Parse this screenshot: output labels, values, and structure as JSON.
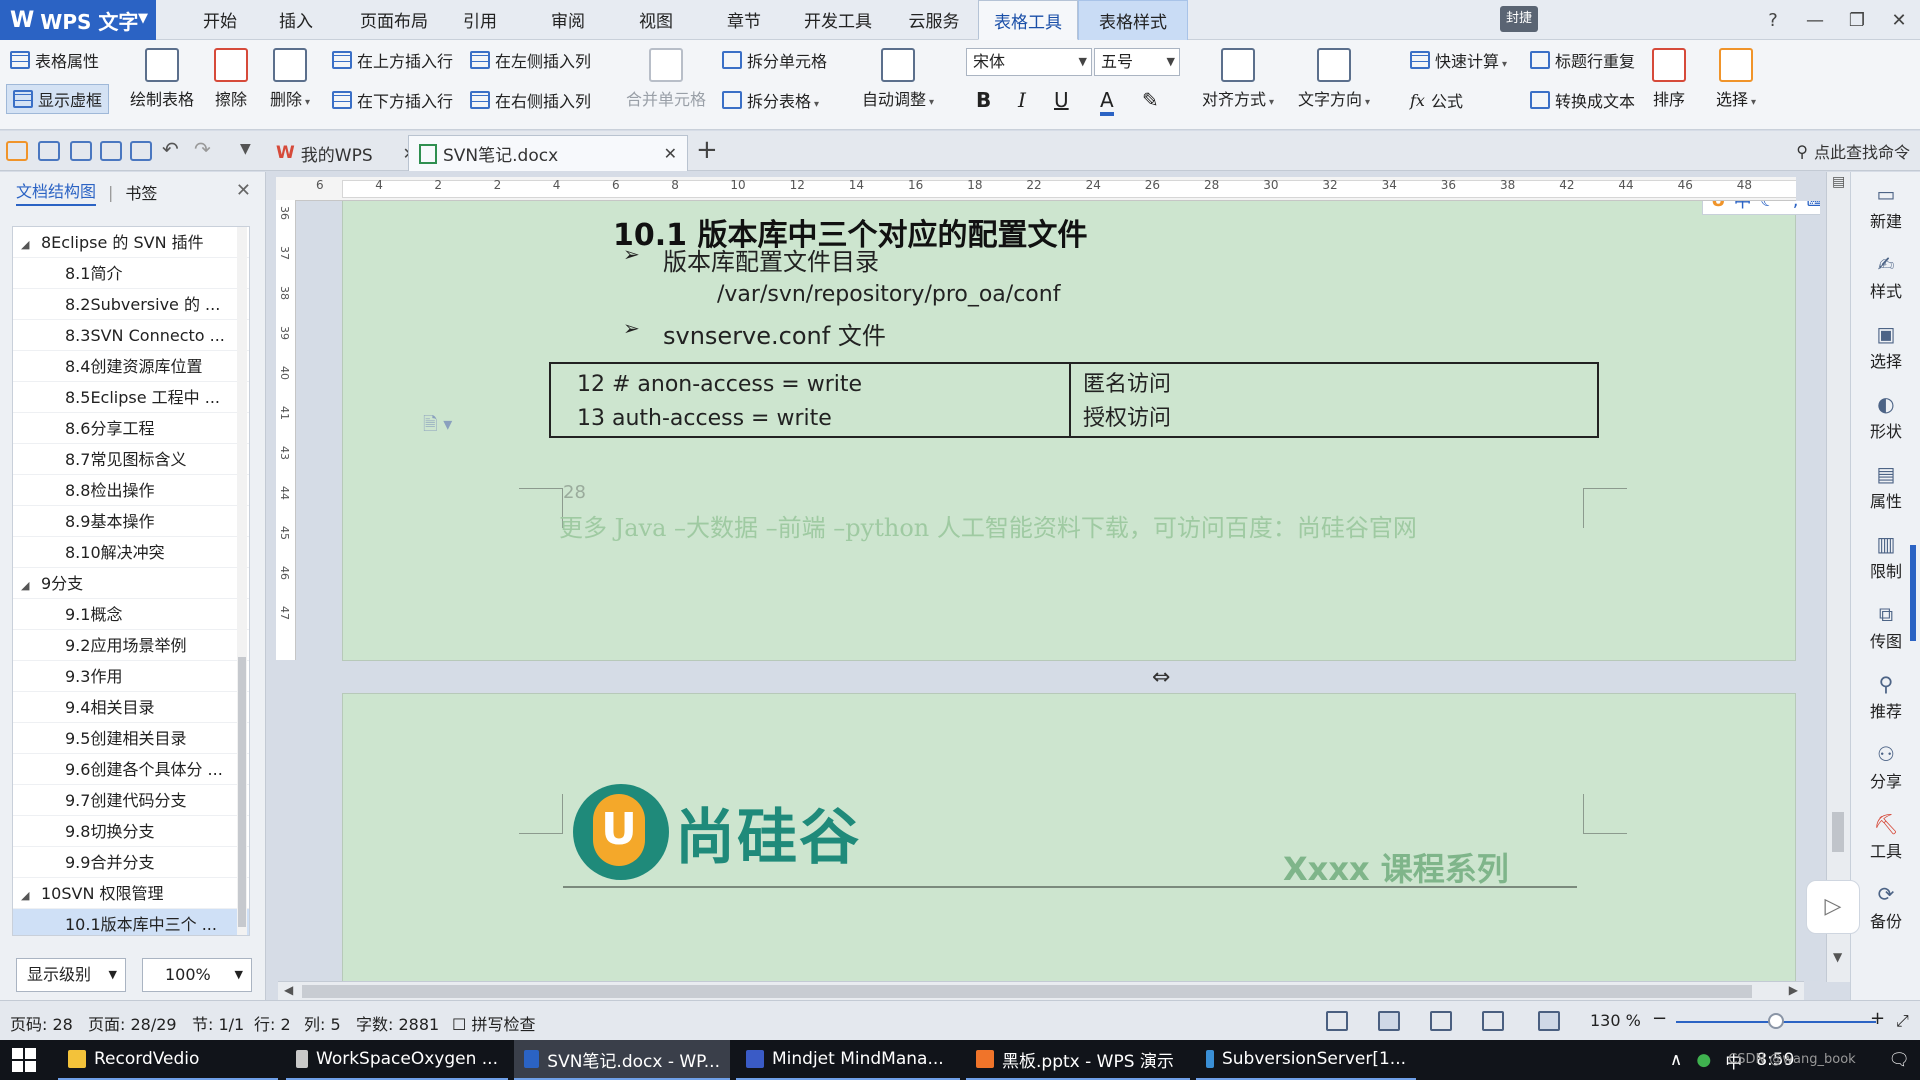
{
  "menubar": {
    "app_label": "WPS 文字",
    "tabs": [
      "开始",
      "插入",
      "页面布局",
      "引用",
      "审阅",
      "视图",
      "章节",
      "开发工具",
      "云服务",
      "表格工具",
      "表格样式"
    ],
    "user_label": "封捷",
    "window_controls": [
      "?",
      "—",
      "❐",
      "✕"
    ]
  },
  "ribbon": {
    "table_props": "表格属性",
    "show_gridlines": "显示虚框",
    "draw_table": "绘制表格",
    "eraser": "擦除",
    "delete": "删除",
    "insert_above": "在上方插入行",
    "insert_below": "在下方插入行",
    "insert_left": "在左侧插入列",
    "insert_right": "在右侧插入列",
    "merge_cells": "合并单元格",
    "split_cells": "拆分单元格",
    "split_table": "拆分表格",
    "auto_fit": "自动调整",
    "font_name": "宋体",
    "font_size": "五号",
    "bold": "B",
    "italic": "I",
    "underline": "U",
    "font_color": "A",
    "align": "对齐方式",
    "text_direction": "文字方向",
    "quick_calc": "快速计算",
    "formula": "公式",
    "repeat_header": "标题行重复",
    "to_text": "转换成文本",
    "sort": "排序",
    "select": "选择"
  },
  "tabbar": {
    "home_tab": "我的WPS",
    "doc_tab": "SVN笔记.docx",
    "search_cmd": "点此查找命令"
  },
  "nav": {
    "tab_outline": "文档结构图",
    "tab_bookmark": "书签",
    "items": [
      {
        "label": "8Eclipse 的 SVN 插件",
        "level": 1
      },
      {
        "label": "8.1简介",
        "level": 2
      },
      {
        "label": "8.2Subversive 的 ...",
        "level": 2
      },
      {
        "label": "8.3SVN Connecto ...",
        "level": 2
      },
      {
        "label": "8.4创建资源库位置",
        "level": 2
      },
      {
        "label": "8.5Eclipse 工程中 ...",
        "level": 2
      },
      {
        "label": "8.6分享工程",
        "level": 2
      },
      {
        "label": "8.7常见图标含义",
        "level": 2
      },
      {
        "label": "8.8检出操作",
        "level": 2
      },
      {
        "label": "8.9基本操作",
        "level": 2
      },
      {
        "label": "8.10解决冲突",
        "level": 2
      },
      {
        "label": "9分支",
        "level": 1
      },
      {
        "label": "9.1概念",
        "level": 2
      },
      {
        "label": "9.2应用场景举例",
        "level": 2
      },
      {
        "label": "9.3作用",
        "level": 2
      },
      {
        "label": "9.4相关目录",
        "level": 2
      },
      {
        "label": "9.5创建相关目录",
        "level": 2
      },
      {
        "label": "9.6创建各个具体分 ...",
        "level": 2
      },
      {
        "label": "9.7创建代码分支",
        "level": 2
      },
      {
        "label": "9.8切换分支",
        "level": 2
      },
      {
        "label": "9.9合并分支",
        "level": 2
      },
      {
        "label": "10SVN 权限管理",
        "level": 1
      },
      {
        "label": "10.1版本库中三个 ...",
        "level": 2
      }
    ],
    "level_select": "显示级别",
    "zoom_select": "100%"
  },
  "doc": {
    "heading": "10.1 版本库中三个对应的配置文件",
    "bullet1": "版本库配置文件目录",
    "path_line": "/var/svn/repository/pro_oa/conf",
    "bullet2": "svnserve.conf 文件",
    "table": [
      [
        "12 # anon-access = write",
        "匿名访问"
      ],
      [
        "13 auth-access = write",
        "授权访问"
      ]
    ],
    "page_number": "28",
    "footer_note": "更多 Java –大数据 –前端 –python 人工智能资料下载，可访问百度：尚硅谷官网",
    "logo_text": "尚硅谷",
    "logo_letter": "U",
    "series_text": "Xxxx 课程系列"
  },
  "ruler": {
    "h_ticks": [
      "6",
      "4",
      "2",
      "2",
      "4",
      "6",
      "8",
      "10",
      "12",
      "14",
      "16",
      "18",
      "22",
      "24",
      "26",
      "28",
      "30",
      "32",
      "34",
      "36",
      "38",
      "42",
      "44",
      "46",
      "48"
    ],
    "v_ticks": [
      "36",
      "37",
      "38",
      "39",
      "40",
      "41",
      "43",
      "44",
      "45",
      "46",
      "47"
    ]
  },
  "rightbar": {
    "items": [
      "新建",
      "样式",
      "选择",
      "形状",
      "属性",
      "限制",
      "传图",
      "推荐",
      "分享",
      "工具",
      "备份"
    ]
  },
  "statusbar": {
    "page_code": "页码: 28",
    "page": "页面: 28/29",
    "section": "节: 1/1",
    "row": "行: 2",
    "col": "列: 5",
    "words": "字数: 2881",
    "spell": "拼写检查",
    "zoom": "130 %"
  },
  "taskbar": {
    "items": [
      "RecordVedio",
      "WorkSpaceOxygen ...",
      "SVN笔记.docx - WP...",
      "Mindjet MindMana...",
      "黑板.pptx - WPS 演示",
      "SubversionServer[1..."
    ],
    "time": "8:59",
    "ime": "中",
    "tray_note": "CSDN @wang_book"
  }
}
